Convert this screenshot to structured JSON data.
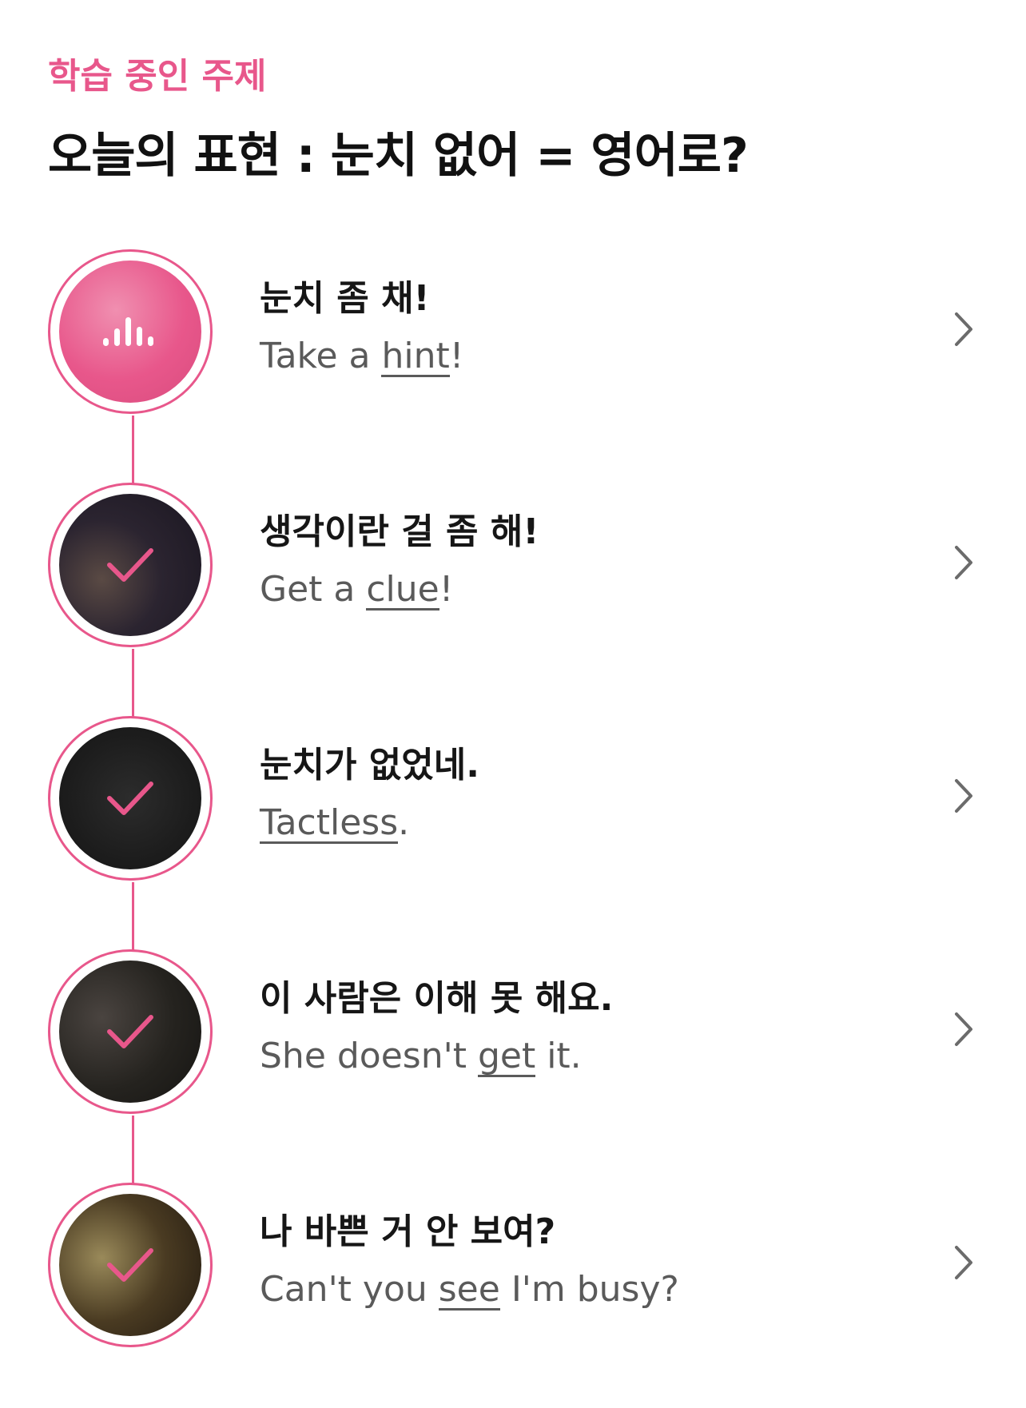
{
  "header": {
    "eyebrow": "학습 중인 주제",
    "title": "오늘의 표현 : 눈치 없어 = 영어로?"
  },
  "colors": {
    "accent": "#e8578b",
    "title_text": "#111111",
    "subtitle_text": "#5a5a5a"
  },
  "lessons": [
    {
      "ko": "눈치 좀 채!",
      "en_before": "Take a ",
      "en_key": "hint",
      "en_after": "!",
      "status": "playing",
      "icon": "audio-wave-icon"
    },
    {
      "ko": "생각이란 걸 좀 해!",
      "en_before": "Get a ",
      "en_key": "clue",
      "en_after": "!",
      "status": "completed",
      "icon": "checkmark-icon"
    },
    {
      "ko": "눈치가 없었네.",
      "en_before": "",
      "en_key": "Tactless",
      "en_after": ".",
      "status": "completed",
      "icon": "checkmark-icon"
    },
    {
      "ko": "이 사람은 이해 못 해요.",
      "en_before": "She doesn't ",
      "en_key": "get",
      "en_after": " it.",
      "status": "completed",
      "icon": "checkmark-icon"
    },
    {
      "ko": "나 바쁜 거 안 보여?",
      "en_before": "Can't you ",
      "en_key": "see",
      "en_after": " I'm busy?",
      "status": "completed",
      "icon": "checkmark-icon"
    }
  ]
}
